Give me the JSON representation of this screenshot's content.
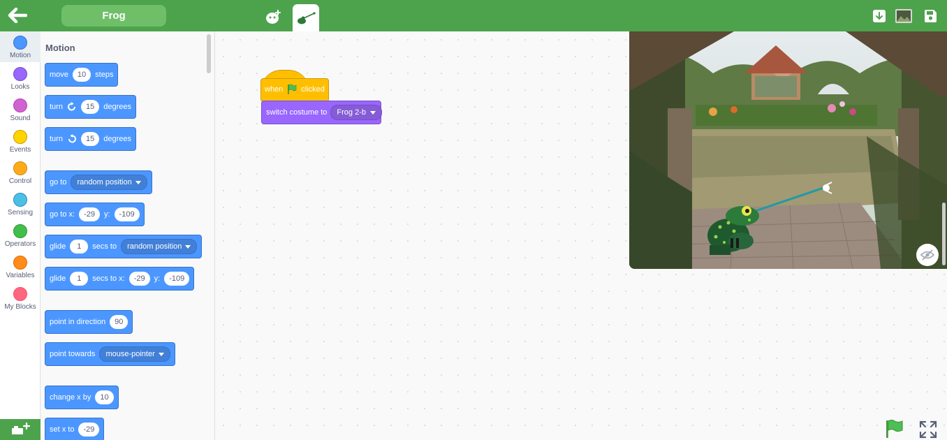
{
  "topbar": {
    "sprite_name": "Frog",
    "icons": {
      "back": "back-arrow-icon",
      "sprite_tab": "sprite-tab-icon",
      "costume_tab": "costume-tab-icon",
      "download": "download-icon",
      "thumbnail": "project-thumbnail-icon",
      "save": "save-icon"
    }
  },
  "categories": [
    {
      "label": "Motion",
      "color": "#4c97ff",
      "active": true
    },
    {
      "label": "Looks",
      "color": "#9966ff"
    },
    {
      "label": "Sound",
      "color": "#cf63cf"
    },
    {
      "label": "Events",
      "color": "#ffd500"
    },
    {
      "label": "Control",
      "color": "#ffab19"
    },
    {
      "label": "Sensing",
      "color": "#4cbfe6"
    },
    {
      "label": "Operators",
      "color": "#40bf4a"
    },
    {
      "label": "Variables",
      "color": "#ff8c1a"
    },
    {
      "label": "My Blocks",
      "color": "#ff6680"
    }
  ],
  "palette": {
    "title": "Motion",
    "blocks": {
      "move": {
        "t1": "move",
        "v1": "10",
        "t2": "steps"
      },
      "turn_right": {
        "t1": "turn",
        "v1": "15",
        "t2": "degrees"
      },
      "turn_left": {
        "t1": "turn",
        "v1": "15",
        "t2": "degrees"
      },
      "go_to": {
        "t1": "go to",
        "d1": "random position"
      },
      "go_to_xy": {
        "t1": "go to x:",
        "v1": "-29",
        "t2": "y:",
        "v2": "-109"
      },
      "glide_to": {
        "t1": "glide",
        "v1": "1",
        "t2": "secs to",
        "d1": "random position"
      },
      "glide_xy": {
        "t1": "glide",
        "v1": "1",
        "t2": "secs to x:",
        "v2": "-29",
        "t3": "y:",
        "v3": "-109"
      },
      "point_dir": {
        "t1": "point in direction",
        "v1": "90"
      },
      "point_towards": {
        "t1": "point towards",
        "d1": "mouse-pointer"
      },
      "change_x": {
        "t1": "change x by",
        "v1": "10"
      },
      "set_x": {
        "t1": "set x to",
        "v1": "-29"
      }
    }
  },
  "script": {
    "hat": {
      "t1": "when",
      "t2": "clicked"
    },
    "switch_costume": {
      "t1": "switch costume to",
      "d1": "Frog 2-b"
    }
  },
  "colors": {
    "topbar": "#4ca34c",
    "motion": "#4c97ff",
    "events": "#ffbf00",
    "looks": "#9966ff"
  }
}
